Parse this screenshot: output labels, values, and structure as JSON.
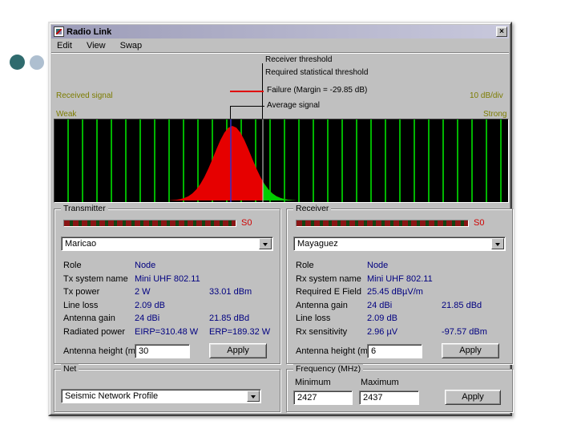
{
  "window": {
    "title": "Radio Link",
    "close_label": "×",
    "menu": [
      "Edit",
      "View",
      "Swap"
    ]
  },
  "plot": {
    "receiver_threshold_label": "Receiver threshold",
    "required_threshold_label": "Required statistical threshold",
    "failure_label": "Failure (Margin = -29.85 dB)",
    "average_signal_label": "Average signal",
    "received_signal_label": "Received signal",
    "weak_label": "Weak",
    "scale_label": "10 dB/div",
    "strong_label": "Strong",
    "colors": {
      "background": "#000000",
      "grid_line": "#00b400",
      "signal_fill": "#e60000",
      "pass_fill": "#00cc00",
      "average_line": "#3333cc",
      "threshold_line": "#d8d8d8"
    }
  },
  "transmitter": {
    "group_label": "Transmitter",
    "meter_label": "S0",
    "unit_selected": "Maricao",
    "rows": [
      {
        "label": "Role",
        "value": "Node",
        "value2": ""
      },
      {
        "label": "Tx system name",
        "value": "Mini UHF 802.11",
        "value2": ""
      },
      {
        "label": "Tx power",
        "value": "2 W",
        "value2": "33.01 dBm"
      },
      {
        "label": "Line loss",
        "value": "2.09 dB",
        "value2": ""
      },
      {
        "label": "Antenna gain",
        "value": "24 dBi",
        "value2": "21.85 dBd"
      },
      {
        "label": "Radiated power",
        "value": "EIRP=310.48 W",
        "value2": "ERP=189.32 W"
      }
    ],
    "antenna_height_label": "Antenna height (m)",
    "antenna_height_value": "30",
    "apply_label": "Apply"
  },
  "receiver": {
    "group_label": "Receiver",
    "meter_label": "S0",
    "unit_selected": "Mayaguez",
    "rows": [
      {
        "label": "Role",
        "value": "Node",
        "value2": ""
      },
      {
        "label": "Rx system name",
        "value": "Mini UHF 802.11",
        "value2": ""
      },
      {
        "label": "Required E Field",
        "value": "25.45 dBµV/m",
        "value2": ""
      },
      {
        "label": "Antenna gain",
        "value": "24 dBi",
        "value2": "21.85 dBd"
      },
      {
        "label": "Line loss",
        "value": "2.09 dB",
        "value2": ""
      },
      {
        "label": "Rx sensitivity",
        "value": "2.96 µV",
        "value2": "-97.57 dBm"
      }
    ],
    "antenna_height_label": "Antenna height (m)",
    "antenna_height_value": "6",
    "apply_label": "Apply"
  },
  "net": {
    "group_label": "Net",
    "selected": "Seismic Network Profile"
  },
  "frequency": {
    "group_label": "Frequency (MHz)",
    "minimum_label": "Minimum",
    "maximum_label": "Maximum",
    "minimum_value": "2427",
    "maximum_value": "2437",
    "apply_label": "Apply"
  }
}
